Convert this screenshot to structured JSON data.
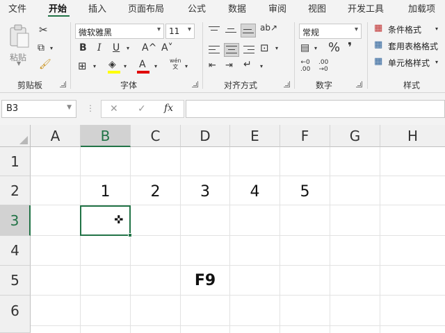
{
  "menu": {
    "tabs": [
      "文件",
      "开始",
      "插入",
      "页面布局",
      "公式",
      "数据",
      "审阅",
      "视图",
      "开发工具",
      "加载项"
    ],
    "active": "开始"
  },
  "ribbon": {
    "clipboard": {
      "paste_label": "粘贴",
      "group_label": "剪贴板"
    },
    "font": {
      "font_name": "微软雅黑",
      "font_size": "11",
      "bold": "B",
      "italic": "I",
      "underline": "U",
      "grow": "A^",
      "shrink": "A˅",
      "phonetic": "wén\n文",
      "font_color": "#e00000",
      "highlight_color": "#ffff00",
      "group_label": "字体"
    },
    "alignment": {
      "group_label": "对齐方式"
    },
    "number": {
      "format": "常规",
      "percent": "%",
      "comma": "❜",
      "group_label": "数字"
    },
    "styles": {
      "conditional": "条件格式",
      "table": "套用表格格式",
      "cell_styles": "单元格样式",
      "group_label": "样式"
    }
  },
  "formula_bar": {
    "name_box": "B3",
    "cancel": "✕",
    "enter": "✓",
    "fx": "fx",
    "formula": ""
  },
  "sheet": {
    "columns": [
      "A",
      "B",
      "C",
      "D",
      "E",
      "F",
      "G",
      "H"
    ],
    "selected_column": "B",
    "rows": [
      "1",
      "2",
      "3",
      "4",
      "5",
      "6"
    ],
    "selected_row": "3",
    "selected_cell": "B3",
    "accent_color": "#217346",
    "cells": [
      {
        "ref": "B2",
        "value": "1"
      },
      {
        "ref": "C2",
        "value": "2"
      },
      {
        "ref": "D2",
        "value": "3"
      },
      {
        "ref": "E2",
        "value": "4"
      },
      {
        "ref": "F2",
        "value": "5"
      },
      {
        "ref": "D5",
        "value": "F9",
        "bold": true
      }
    ]
  }
}
